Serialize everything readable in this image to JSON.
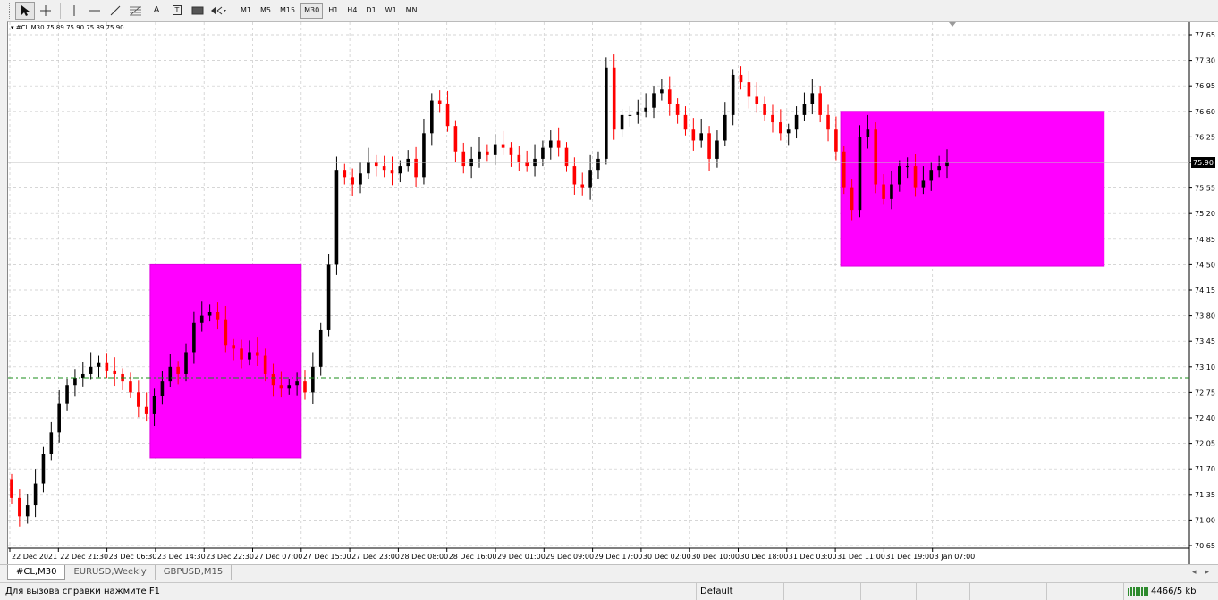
{
  "toolbar": {
    "tools": [
      "cursor",
      "crosshair",
      "vertical-line",
      "horizontal-line",
      "trend-line",
      "fibonacci",
      "text",
      "label",
      "rectangle",
      "arrow"
    ],
    "text_tool_label": "A",
    "label_tool_label": "T",
    "timeframes": [
      "M1",
      "M5",
      "M15",
      "M30",
      "H1",
      "H4",
      "D1",
      "W1",
      "MN"
    ],
    "active_timeframe": "M30"
  },
  "chart": {
    "header": "#CL,M30  75.89 75.90 75.89 75.90",
    "current_price": "75.90",
    "colors": {
      "bull": "#000000",
      "bear": "#ff0000",
      "box": "#ff00ff",
      "dashed": "#1a8c1a",
      "grid": "#c8c8c8"
    }
  },
  "chart_data": {
    "type": "candlestick",
    "symbol": "#CL",
    "timeframe": "M30",
    "ohlc_header": [
      75.89,
      75.9,
      75.89,
      75.9
    ],
    "y_ticks": [
      "77.65",
      "77.30",
      "76.95",
      "76.60",
      "76.25",
      "75.90",
      "75.55",
      "75.20",
      "74.85",
      "74.50",
      "74.15",
      "73.80",
      "73.45",
      "73.10",
      "72.75",
      "72.40",
      "72.05",
      "71.70",
      "71.35",
      "71.00",
      "70.65"
    ],
    "ylim": [
      70.65,
      77.65
    ],
    "x_ticks": [
      "22 Dec 2021",
      "22 Dec 21:30",
      "23 Dec 06:30",
      "23 Dec 14:30",
      "23 Dec 22:30",
      "27 Dec 07:00",
      "27 Dec 15:00",
      "27 Dec 23:00",
      "28 Dec 08:00",
      "28 Dec 16:00",
      "29 Dec 01:00",
      "29 Dec 09:00",
      "29 Dec 17:00",
      "30 Dec 02:00",
      "30 Dec 10:00",
      "30 Dec 18:00",
      "31 Dec 03:00",
      "31 Dec 11:00",
      "31 Dec 19:00",
      "3 Jan 07:00"
    ],
    "closes": [
      71.3,
      71.05,
      71.2,
      71.5,
      71.9,
      72.2,
      72.6,
      72.85,
      72.95,
      73.0,
      73.1,
      73.15,
      73.05,
      73.0,
      72.9,
      72.75,
      72.55,
      72.45,
      72.7,
      72.9,
      73.1,
      73.0,
      73.3,
      73.7,
      73.8,
      73.85,
      73.75,
      73.4,
      73.35,
      73.2,
      73.3,
      73.25,
      73.0,
      72.85,
      72.8,
      72.85,
      72.9,
      72.75,
      73.1,
      73.6,
      74.5,
      75.8,
      75.7,
      75.6,
      75.75,
      75.9,
      75.85,
      75.8,
      75.75,
      75.85,
      75.95,
      75.7,
      76.3,
      76.75,
      76.7,
      76.4,
      76.05,
      75.85,
      75.95,
      76.05,
      76.0,
      76.15,
      76.1,
      76.0,
      75.9,
      75.85,
      75.95,
      76.1,
      76.2,
      76.1,
      75.85,
      75.6,
      75.55,
      75.8,
      75.95,
      77.2,
      76.35,
      76.55,
      76.55,
      76.6,
      76.65,
      76.85,
      76.9,
      76.7,
      76.55,
      76.35,
      76.2,
      76.3,
      75.95,
      76.2,
      76.55,
      77.1,
      77.0,
      76.8,
      76.7,
      76.55,
      76.45,
      76.3,
      76.35,
      76.55,
      76.7,
      76.85,
      76.55,
      76.35,
      76.05,
      75.55,
      75.25,
      76.25,
      76.35,
      75.6,
      75.4,
      75.6,
      75.85,
      75.85,
      75.55,
      75.65,
      75.8,
      75.85,
      75.9
    ],
    "annotations": [
      {
        "type": "rectangle",
        "time_from": "23 Dec 14:30",
        "time_to": "27 Dec 15:00",
        "price_top": 74.5,
        "price_bottom": 71.85
      },
      {
        "type": "rectangle",
        "time_from": "31 Dec 11:00",
        "time_to": "after 3 Jan 07:00",
        "price_top": 76.6,
        "price_bottom": 74.48
      },
      {
        "type": "horizontal-dashed-line",
        "price": 72.95
      },
      {
        "type": "horizontal-line",
        "price": 75.9
      }
    ],
    "grid": true
  },
  "tabs": [
    {
      "label": "#CL,M30",
      "active": true
    },
    {
      "label": "EURUSD,Weekly",
      "active": false
    },
    {
      "label": "GBPUSD,M15",
      "active": false
    }
  ],
  "tab_arrow_left": "◂",
  "tab_arrow_right": "▸",
  "status": {
    "help": "Для вызова справки нажмите F1",
    "profile": "Default",
    "traffic": "4466/5 kb"
  }
}
